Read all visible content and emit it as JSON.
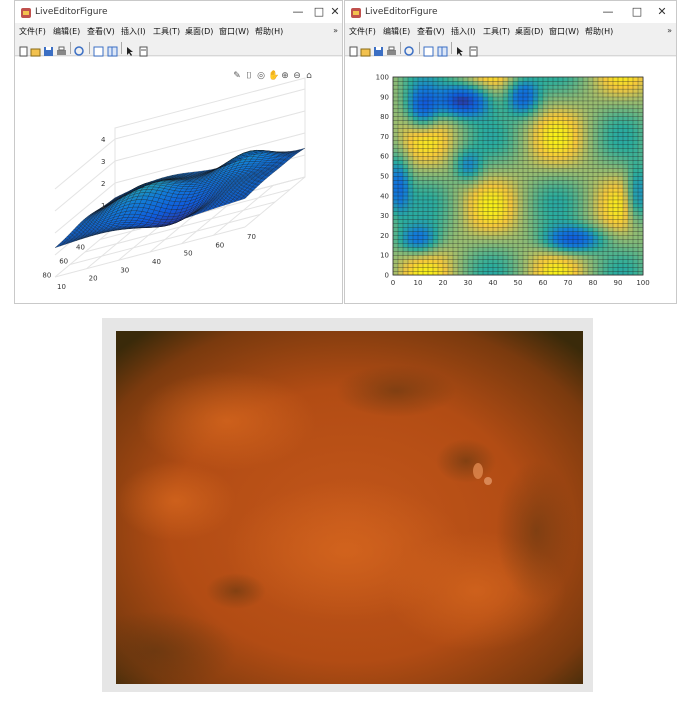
{
  "left_window": {
    "title": "LiveEditorFigure",
    "controls": [
      "—",
      "□",
      "✕"
    ],
    "menu": [
      "文件(F)",
      "编辑(E)",
      "查看(V)",
      "插入(I)",
      "工具(T)",
      "桌面(D)",
      "窗口(W)",
      "帮助(H)"
    ],
    "menu_overflow": "»",
    "toolbar_icons": [
      "new-file-icon",
      "open-folder-icon",
      "save-icon",
      "print-icon",
      "link-icon",
      "panel-icon",
      "layout-icon",
      "pointer-icon",
      "colorbar-icon"
    ],
    "axes_toolbar_icons": [
      "brush-icon",
      "data-tips-icon",
      "rotate-icon",
      "pan-icon",
      "zoom-in-icon",
      "zoom-out-icon",
      "home-icon"
    ]
  },
  "right_window": {
    "title": "LiveEditorFigure",
    "controls": [
      "—",
      "□",
      "✕"
    ],
    "menu": [
      "文件(F)",
      "编辑(E)",
      "查看(V)",
      "插入(I)",
      "工具(T)",
      "桌面(D)",
      "窗口(W)",
      "帮助(H)"
    ],
    "menu_overflow": "»",
    "toolbar_icons": [
      "new-file-icon",
      "open-folder-icon",
      "save-icon",
      "print-icon",
      "link-icon",
      "panel-icon",
      "layout-icon",
      "pointer-icon",
      "colorbar-icon"
    ]
  },
  "chart_data": [
    {
      "type": "surface",
      "title": "",
      "xlabel": "",
      "ylabel": "",
      "zlabel": "",
      "colormap": "parula",
      "z_ticks": [
        "1",
        "2",
        "3",
        "4"
      ],
      "y_ticks": [
        "40",
        "60",
        "80"
      ],
      "x_ticks": [
        "10",
        "20",
        "30",
        "40",
        "50",
        "60",
        "70"
      ],
      "grid": true
    },
    {
      "type": "heatmap",
      "title": "",
      "xlabel": "",
      "ylabel": "",
      "colormap": "parula",
      "x_ticks": [
        "0",
        "10",
        "20",
        "30",
        "40",
        "50",
        "60",
        "70",
        "80",
        "90",
        "100"
      ],
      "y_ticks": [
        "0",
        "10",
        "20",
        "30",
        "40",
        "50",
        "60",
        "70",
        "80",
        "90",
        "100"
      ],
      "xlim": [
        0,
        100
      ],
      "ylim": [
        0,
        100
      ],
      "grid": true
    }
  ],
  "photo": {
    "description_icon": "microscope-image",
    "base_color": "#b04a12",
    "shadow_color": "#3a2a0a"
  }
}
